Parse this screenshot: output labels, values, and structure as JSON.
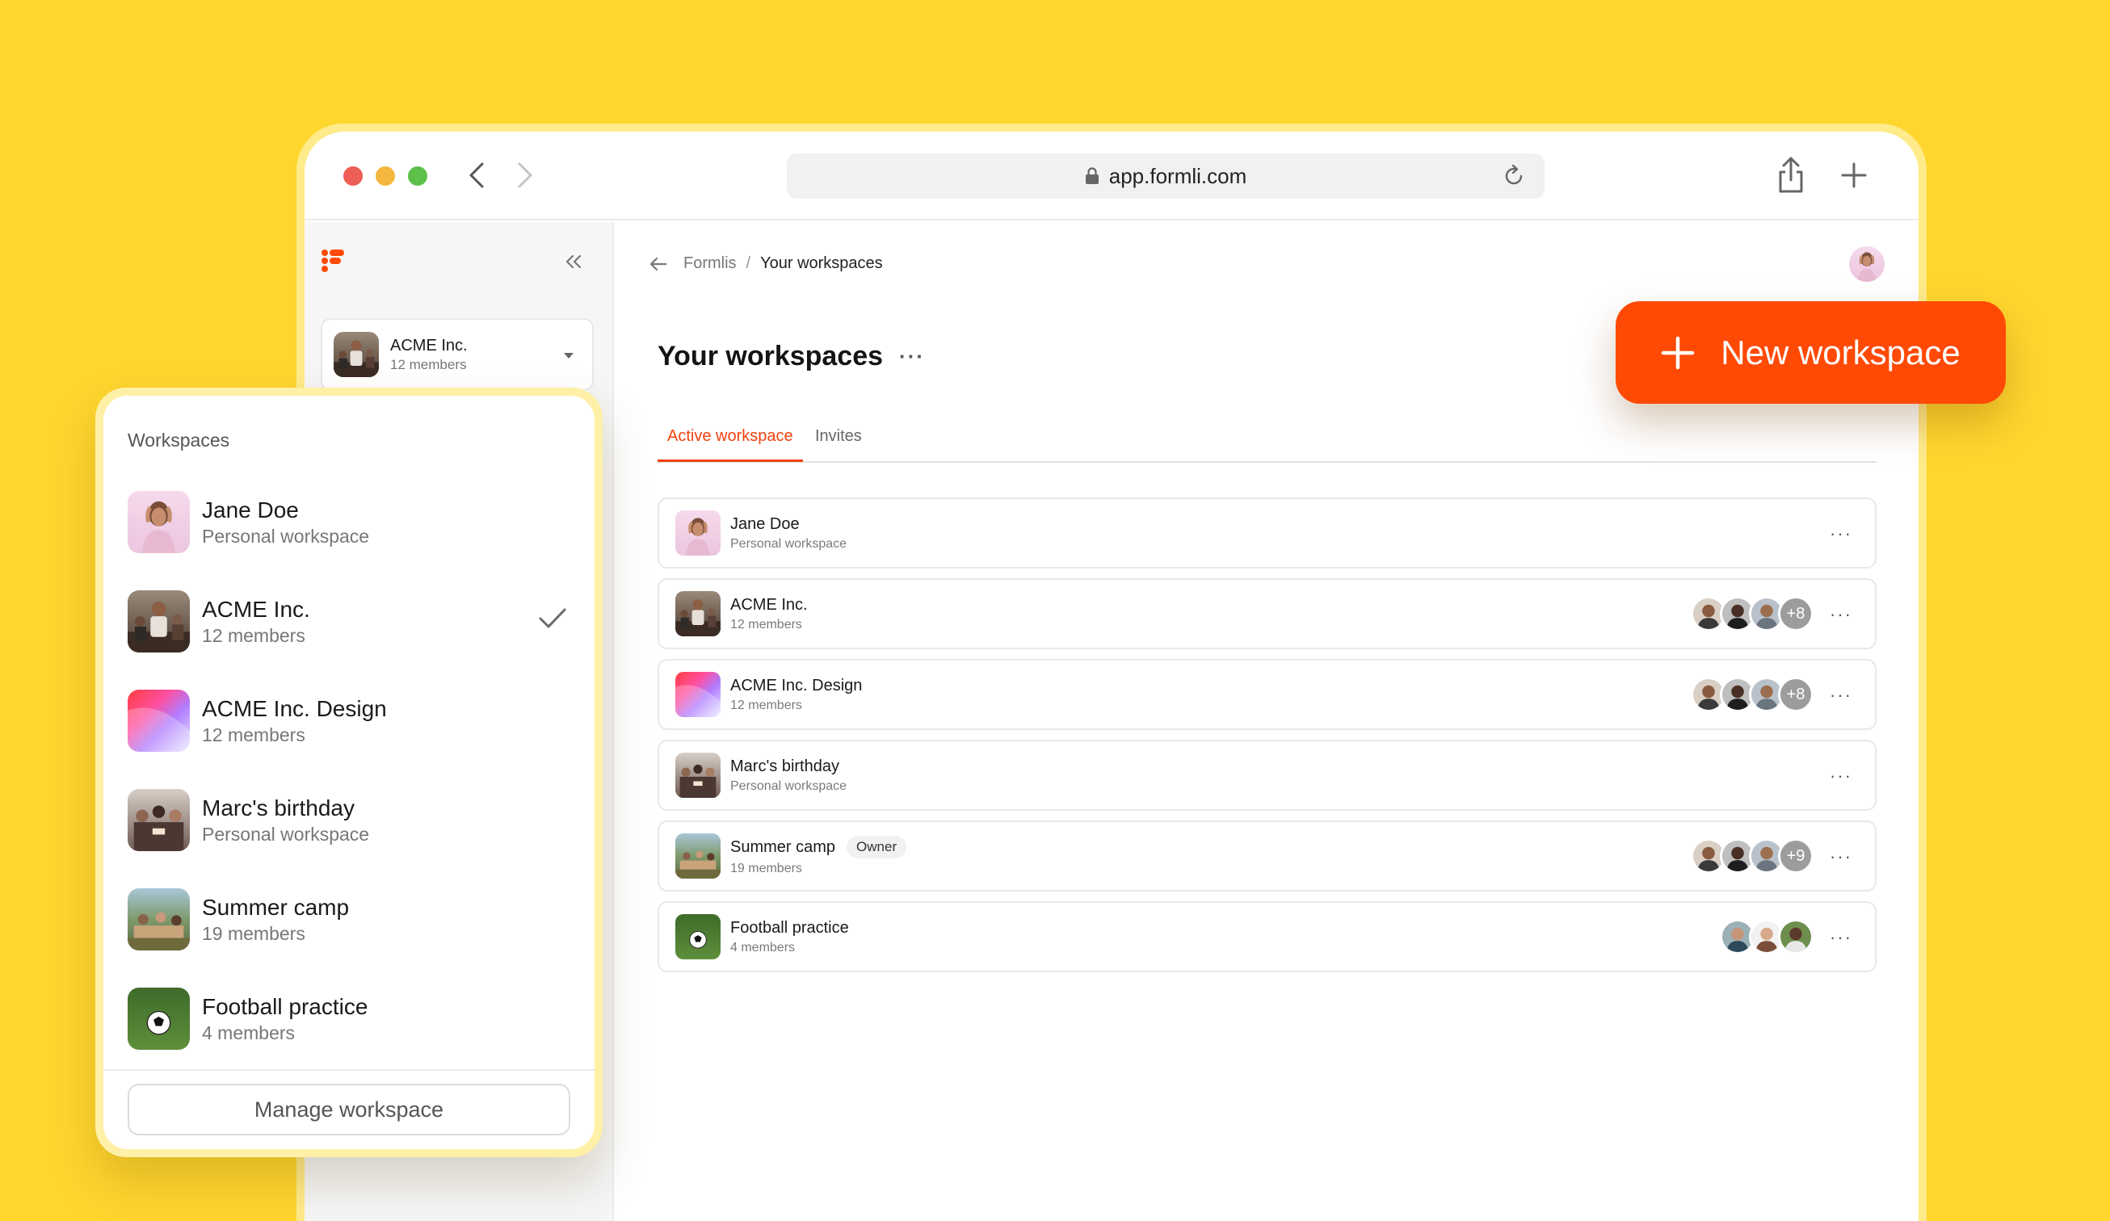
{
  "browser": {
    "url": "app.formli.com"
  },
  "sidebar": {
    "selected": {
      "name": "ACME Inc.",
      "sub": "12 members"
    }
  },
  "breadcrumb": {
    "root": "Formlis",
    "separator": "/",
    "current": "Your workspaces"
  },
  "page": {
    "title": "Your workspaces",
    "more": "···"
  },
  "tabs": [
    {
      "label": "Active workspace",
      "active": true
    },
    {
      "label": "Invites",
      "active": false
    }
  ],
  "workspaces": [
    {
      "name": "Jane Doe",
      "sub": "Personal workspace",
      "badge": "",
      "extra": ""
    },
    {
      "name": "ACME Inc.",
      "sub": "12 members",
      "badge": "",
      "extra": "+8"
    },
    {
      "name": "ACME Inc. Design",
      "sub": "12 members",
      "badge": "",
      "extra": "+8"
    },
    {
      "name": "Marc's birthday",
      "sub": "Personal workspace",
      "badge": "",
      "extra": ""
    },
    {
      "name": "Summer camp",
      "sub": "19 members",
      "badge": "Owner",
      "extra": "+9"
    },
    {
      "name": "Football practice",
      "sub": "4 members",
      "badge": "",
      "extra": ""
    }
  ],
  "row_more": "···",
  "new_workspace": {
    "label": "New workspace"
  },
  "dropdown": {
    "heading": "Workspaces",
    "items": [
      {
        "name": "Jane Doe",
        "sub": "Personal workspace",
        "checked": false
      },
      {
        "name": "ACME Inc.",
        "sub": "12 members",
        "checked": true
      },
      {
        "name": "ACME Inc. Design",
        "sub": "12 members",
        "checked": false
      },
      {
        "name": "Marc's birthday",
        "sub": "Personal workspace",
        "checked": false
      },
      {
        "name": "Summer camp",
        "sub": "19 members",
        "checked": false
      },
      {
        "name": "Football practice",
        "sub": "4 members",
        "checked": false
      }
    ],
    "manage_label": "Manage workspace"
  },
  "colors": {
    "background": "#FFD62E",
    "accent": "#FF4A05",
    "tab_active": "#F0420F"
  }
}
